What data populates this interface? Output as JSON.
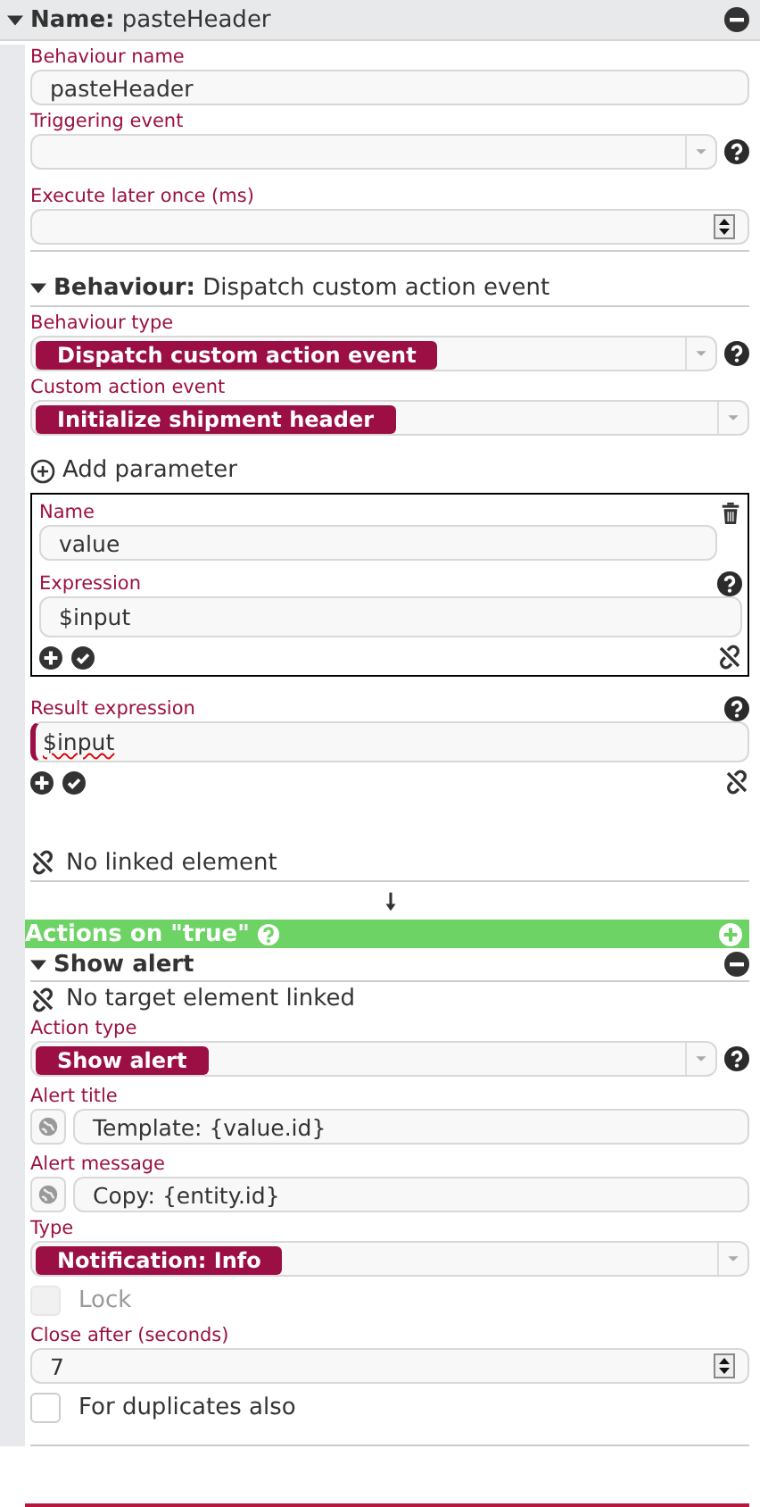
{
  "behaviour": {
    "expanded": true,
    "title_label": "Name:",
    "title_value": "pasteHeader",
    "fields": [
      {
        "kind": "text",
        "label": "Behaviour name",
        "value": "pasteHeader"
      },
      {
        "kind": "select",
        "label": "Triggering event",
        "help": true
      },
      {
        "kind": "number",
        "label": "Execute later once (ms)"
      }
    ],
    "details": {
      "expanded": true,
      "title_label": "Behaviour:",
      "title_value": "Dispatch custom action event",
      "fields": [
        {
          "kind": "select",
          "label": "Behaviour type",
          "value": "Dispatch custom action event",
          "help": true
        },
        {
          "kind": "select",
          "label": "Custom action event",
          "value": "Initialize shipment header"
        }
      ]
    },
    "add_parameter": "Add parameter",
    "parameters": [
      {
        "name_label": "Name",
        "name": "value",
        "expression_label": "Expression",
        "expression": "$input"
      }
    ],
    "result_expression": {
      "label": "Result expression",
      "value": "$input"
    },
    "link_status": "No linked element"
  },
  "actions_true": {
    "title": "Actions on \"true\"",
    "actions": [
      {
        "expanded": true,
        "title": "Show alert",
        "link_status": "No target element linked",
        "fields": [
          {
            "kind": "select",
            "label": "Action type",
            "value": "Show alert",
            "help": true
          },
          {
            "kind": "template",
            "label": "Alert title",
            "value": "Template: {value.id}"
          },
          {
            "kind": "template",
            "label": "Alert message",
            "value": "Copy: {entity.id}"
          },
          {
            "kind": "select",
            "label": "Type",
            "value": "Notification: Info"
          },
          {
            "kind": "checkbox",
            "label": "Lock",
            "checked": false,
            "disabled": true
          },
          {
            "kind": "number",
            "label": "Close after (seconds)",
            "value": "7"
          },
          {
            "kind": "checkbox",
            "label": "For duplicates also",
            "checked": false,
            "disabled": false
          }
        ]
      }
    ]
  }
}
